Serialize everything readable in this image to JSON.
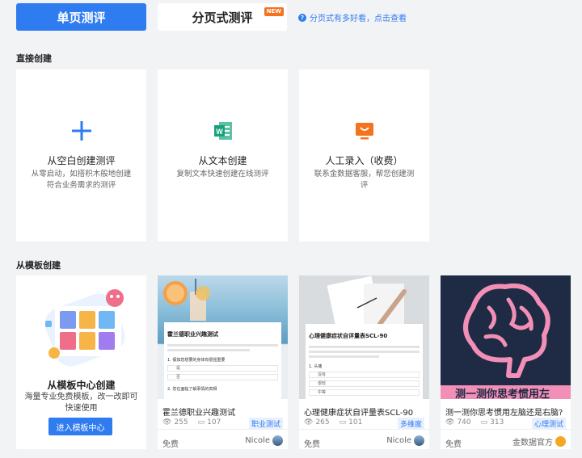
{
  "tabs": {
    "single": "单页测评",
    "paged": "分页式测评",
    "new_badge": "NEW"
  },
  "help_link": "分页式有多好看，点击查看",
  "sections": {
    "direct": "直接创建",
    "template": "从模板创建"
  },
  "create_cards": [
    {
      "title": "从空白创建测评",
      "desc": "从零启动，如搭积木般地创建符合业务需求的测评",
      "icon": "plus-icon"
    },
    {
      "title": "从文本创建",
      "desc": "复制文本快速创建在线测评",
      "icon": "word-doc-icon"
    },
    {
      "title": "人工录入（收费）",
      "desc": "联系金数据客服，帮您创建测评",
      "icon": "customer-service-icon"
    }
  ],
  "template_center": {
    "title": "从模板中心创建",
    "desc": "海量专业免费模板，改一改即可快速使用",
    "button": "进入模板中心"
  },
  "templates": [
    {
      "name": "霍兰德职业兴趣测试",
      "views": "255",
      "comments": "107",
      "tag": "职业测试",
      "price": "免费",
      "author": "Nicole",
      "thumb_title": "霍兰德职业兴趣测试",
      "q1": "1. 假如您想要的身体有很强重要",
      "opts": [
        "是",
        "否"
      ],
      "q2": "2. 您在面临了解事情的真相"
    },
    {
      "name": "心理健康症状自评量表SCL-90",
      "views": "265",
      "comments": "101",
      "tag": "多维度",
      "price": "免费",
      "author": "Nicole",
      "thumb_title": "心理健康症状自评量表SCL-90",
      "q1": "1. 头痛",
      "opts": [
        "没有",
        "很轻",
        "中等"
      ]
    },
    {
      "name": "测一测你思考惯用左脑还是右脑?",
      "views": "740",
      "comments": "313",
      "tag": "心理测试",
      "price": "免费",
      "author": "金数据官方",
      "thumb_title": "测一测你思考惯用左"
    }
  ],
  "colors": {
    "accent": "#2f7bf0",
    "new_badge": "#f5731f",
    "brain_bg": "#1f2a44",
    "brain_pink": "#f28fb6"
  }
}
